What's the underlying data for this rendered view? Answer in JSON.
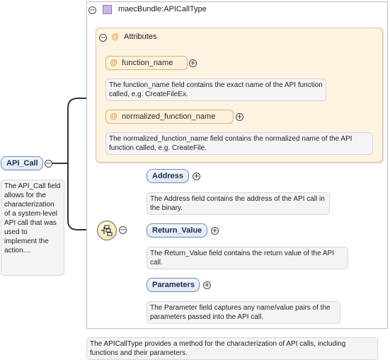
{
  "type_box": {
    "title": "maecBundle:APICallType",
    "description": "The APICallType provides a method for the characterization of API calls, including functions and their parameters."
  },
  "attributes": {
    "header": "Attributes",
    "items": [
      {
        "name": "function_name",
        "description": "The function_name field contains the exact name of the API function called, e.g. CreateFileEx."
      },
      {
        "name": "normalized_function_name",
        "description": "The normalized_function_name field contains the normalized name of the API function called, e.g. CreateFile."
      }
    ]
  },
  "root_element": {
    "name": "API_Call",
    "description": "The API_Call field allows for the characterization of a system-level API call that was used to implement the action...."
  },
  "children": [
    {
      "name": "Address",
      "description": "The Address field contains the address of the API call in the binary."
    },
    {
      "name": "Return_Value",
      "description": "The Return_Value field contains the return value of the API call."
    },
    {
      "name": "Parameters",
      "description": "The Parameter field captures any name/value pairs of the parameters passed into the API call."
    }
  ],
  "icons": {
    "collapse": "minus-circle-icon",
    "expand": "plus-circle-icon",
    "type": "complex-type-icon",
    "attribute": "at-sign-icon",
    "sequence": "sequence-compositor-icon"
  },
  "colors": {
    "attributes_panel_bg": "#fdf3e0",
    "element_fill": "#e4ecf8",
    "element_border": "#6f86b4",
    "attribute_fill": "#fdf1da",
    "type_icon": "#b9a6d6"
  }
}
